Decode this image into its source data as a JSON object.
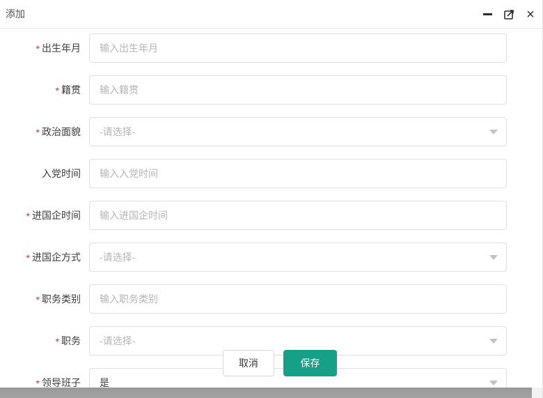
{
  "window": {
    "title": "添加",
    "controls": {
      "minimize": "minimize",
      "maximize": "maximize",
      "close": "×"
    }
  },
  "form": {
    "required_marker": "*",
    "fields": [
      {
        "label": "出生年月",
        "required": true,
        "type": "input",
        "placeholder": "输入出生年月"
      },
      {
        "label": "籍贯",
        "required": true,
        "type": "input",
        "placeholder": "输入籍贯"
      },
      {
        "label": "政治面貌",
        "required": true,
        "type": "select",
        "value": "-请选择-",
        "selected": false
      },
      {
        "label": "入党时间",
        "required": false,
        "type": "input",
        "placeholder": "输入入党时间"
      },
      {
        "label": "进国企时间",
        "required": true,
        "type": "input",
        "placeholder": "输入进国企时间"
      },
      {
        "label": "进国企方式",
        "required": true,
        "type": "select",
        "value": "-请选择-",
        "selected": false
      },
      {
        "label": "职务类别",
        "required": true,
        "type": "input",
        "placeholder": "输入职务类别"
      },
      {
        "label": "职务",
        "required": true,
        "type": "select",
        "value": "-请选择-",
        "selected": false
      },
      {
        "label": "领导班子",
        "required": true,
        "type": "select",
        "value": "是",
        "selected": true
      }
    ]
  },
  "footer": {
    "cancel_label": "取消",
    "save_label": "保存"
  },
  "colors": {
    "accent": "#17a088",
    "required": "#f42525",
    "input_border": "#dddfe3",
    "placeholder": "#b5b5b5",
    "scrollbar_thumb": "#9c9c9c"
  }
}
